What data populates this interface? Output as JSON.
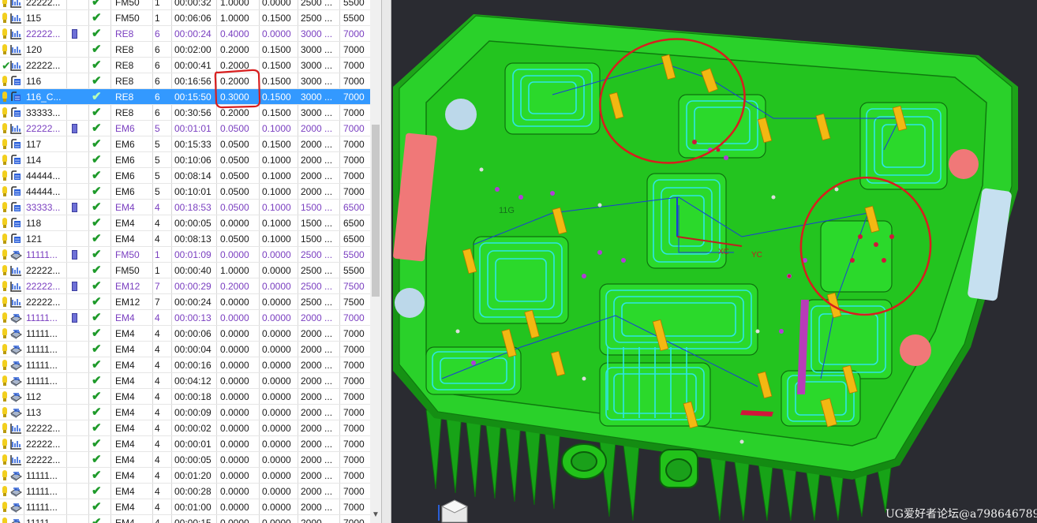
{
  "navigator": {
    "rows": [
      {
        "mark": "bulb",
        "op": "path",
        "name": "22222...",
        "param": false,
        "tool": "FM50",
        "n": "1",
        "time": "00:00:32",
        "a": "1.0000",
        "b": "0.0000",
        "s": "2500 ...",
        "f": "5500"
      },
      {
        "mark": "bulb",
        "op": "path",
        "name": "115",
        "param": false,
        "tool": "FM50",
        "n": "1",
        "time": "00:06:06",
        "a": "1.0000",
        "b": "0.1500",
        "s": "2500 ...",
        "f": "5500"
      },
      {
        "mark": "bulb",
        "op": "path",
        "name": "22222...",
        "param": true,
        "tool": "RE8",
        "n": "6",
        "time": "00:00:24",
        "a": "0.4000",
        "b": "0.0000",
        "s": "3000 ...",
        "f": "7000",
        "group": true
      },
      {
        "mark": "bulb",
        "op": "path",
        "name": "120",
        "param": false,
        "tool": "RE8",
        "n": "6",
        "time": "00:02:00",
        "a": "0.2000",
        "b": "0.1500",
        "s": "3000 ...",
        "f": "7000"
      },
      {
        "mark": "ok",
        "op": "path",
        "name": "22222...",
        "param": false,
        "tool": "RE8",
        "n": "6",
        "time": "00:00:41",
        "a": "0.2000",
        "b": "0.1500",
        "s": "3000 ...",
        "f": "7000"
      },
      {
        "mark": "bulb",
        "op": "zlevel",
        "name": "116",
        "param": false,
        "tool": "RE8",
        "n": "6",
        "time": "00:16:56",
        "a": "0.2000",
        "b": "0.1500",
        "s": "3000 ...",
        "f": "7000"
      },
      {
        "mark": "bulb",
        "op": "zlevel",
        "name": "116_C...",
        "param": false,
        "tool": "RE8",
        "n": "6",
        "time": "00:15:50",
        "a": "0.3000",
        "b": "0.1500",
        "s": "3000 ...",
        "f": "7000",
        "hl": true
      },
      {
        "mark": "bulb",
        "op": "zlevel",
        "name": "33333...",
        "param": false,
        "tool": "RE8",
        "n": "6",
        "time": "00:30:56",
        "a": "0.2000",
        "b": "0.1500",
        "s": "3000 ...",
        "f": "7000"
      },
      {
        "mark": "bulb",
        "op": "path",
        "name": "22222...",
        "param": true,
        "tool": "EM6",
        "n": "5",
        "time": "00:01:01",
        "a": "0.0500",
        "b": "0.1000",
        "s": "2000 ...",
        "f": "7000",
        "group": true
      },
      {
        "mark": "bulb",
        "op": "zlevel",
        "name": "117",
        "param": false,
        "tool": "EM6",
        "n": "5",
        "time": "00:15:33",
        "a": "0.0500",
        "b": "0.1500",
        "s": "2000 ...",
        "f": "7000"
      },
      {
        "mark": "bulb",
        "op": "zlevel",
        "name": "114",
        "param": false,
        "tool": "EM6",
        "n": "5",
        "time": "00:10:06",
        "a": "0.0500",
        "b": "0.1000",
        "s": "2000 ...",
        "f": "7000"
      },
      {
        "mark": "bulb",
        "op": "zlevel",
        "name": "44444...",
        "param": false,
        "tool": "EM6",
        "n": "5",
        "time": "00:08:14",
        "a": "0.0500",
        "b": "0.1000",
        "s": "2000 ...",
        "f": "7000"
      },
      {
        "mark": "bulb",
        "op": "zlevel",
        "name": "44444...",
        "param": false,
        "tool": "EM6",
        "n": "5",
        "time": "00:10:01",
        "a": "0.0500",
        "b": "0.1000",
        "s": "2000 ...",
        "f": "7000"
      },
      {
        "mark": "bulb",
        "op": "zlevel",
        "name": "33333...",
        "param": true,
        "tool": "EM4",
        "n": "4",
        "time": "00:18:53",
        "a": "0.0500",
        "b": "0.1000",
        "s": "1500 ...",
        "f": "6500",
        "group": true
      },
      {
        "mark": "bulb",
        "op": "zlevel",
        "name": "118",
        "param": false,
        "tool": "EM4",
        "n": "4",
        "time": "00:00:05",
        "a": "0.0000",
        "b": "0.1000",
        "s": "1500 ...",
        "f": "6500"
      },
      {
        "mark": "bulb",
        "op": "zlevel",
        "name": "121",
        "param": false,
        "tool": "EM4",
        "n": "4",
        "time": "00:08:13",
        "a": "0.0500",
        "b": "0.1000",
        "s": "1500 ...",
        "f": "6500"
      },
      {
        "mark": "bulb",
        "op": "face",
        "name": "11111...",
        "param": true,
        "tool": "FM50",
        "n": "1",
        "time": "00:01:09",
        "a": "0.0000",
        "b": "0.0000",
        "s": "2500 ...",
        "f": "5500",
        "group": true
      },
      {
        "mark": "bulb",
        "op": "path",
        "name": "22222...",
        "param": false,
        "tool": "FM50",
        "n": "1",
        "time": "00:00:40",
        "a": "1.0000",
        "b": "0.0000",
        "s": "2500 ...",
        "f": "5500"
      },
      {
        "mark": "bulb",
        "op": "path",
        "name": "22222...",
        "param": true,
        "tool": "EM12",
        "n": "7",
        "time": "00:00:29",
        "a": "0.2000",
        "b": "0.0000",
        "s": "2500 ...",
        "f": "7500",
        "group": true
      },
      {
        "mark": "bulb",
        "op": "path",
        "name": "22222...",
        "param": false,
        "tool": "EM12",
        "n": "7",
        "time": "00:00:24",
        "a": "0.0000",
        "b": "0.0000",
        "s": "2500 ...",
        "f": "7500"
      },
      {
        "mark": "bulb",
        "op": "face",
        "name": "11111...",
        "param": true,
        "tool": "EM4",
        "n": "4",
        "time": "00:00:13",
        "a": "0.0000",
        "b": "0.0000",
        "s": "2000 ...",
        "f": "7000",
        "group": true
      },
      {
        "mark": "bulb",
        "op": "face",
        "name": "11111...",
        "param": false,
        "tool": "EM4",
        "n": "4",
        "time": "00:00:06",
        "a": "0.0000",
        "b": "0.0000",
        "s": "2000 ...",
        "f": "7000"
      },
      {
        "mark": "bulb",
        "op": "face",
        "name": "11111...",
        "param": false,
        "tool": "EM4",
        "n": "4",
        "time": "00:00:04",
        "a": "0.0000",
        "b": "0.0000",
        "s": "2000 ...",
        "f": "7000"
      },
      {
        "mark": "bulb",
        "op": "face",
        "name": "11111...",
        "param": false,
        "tool": "EM4",
        "n": "4",
        "time": "00:00:16",
        "a": "0.0000",
        "b": "0.0000",
        "s": "2000 ...",
        "f": "7000"
      },
      {
        "mark": "bulb",
        "op": "face",
        "name": "11111...",
        "param": false,
        "tool": "EM4",
        "n": "4",
        "time": "00:04:12",
        "a": "0.0000",
        "b": "0.0000",
        "s": "2000 ...",
        "f": "7000"
      },
      {
        "mark": "bulb",
        "op": "face",
        "name": "112",
        "param": false,
        "tool": "EM4",
        "n": "4",
        "time": "00:00:18",
        "a": "0.0000",
        "b": "0.0000",
        "s": "2000 ...",
        "f": "7000"
      },
      {
        "mark": "bulb",
        "op": "face",
        "name": "113",
        "param": false,
        "tool": "EM4",
        "n": "4",
        "time": "00:00:09",
        "a": "0.0000",
        "b": "0.0000",
        "s": "2000 ...",
        "f": "7000"
      },
      {
        "mark": "bulb",
        "op": "path",
        "name": "22222...",
        "param": false,
        "tool": "EM4",
        "n": "4",
        "time": "00:00:02",
        "a": "0.0000",
        "b": "0.0000",
        "s": "2000 ...",
        "f": "7000"
      },
      {
        "mark": "bulb",
        "op": "path",
        "name": "22222...",
        "param": false,
        "tool": "EM4",
        "n": "4",
        "time": "00:00:01",
        "a": "0.0000",
        "b": "0.0000",
        "s": "2000 ...",
        "f": "7000"
      },
      {
        "mark": "bulb",
        "op": "path",
        "name": "22222...",
        "param": false,
        "tool": "EM4",
        "n": "4",
        "time": "00:00:05",
        "a": "0.0000",
        "b": "0.0000",
        "s": "2000 ...",
        "f": "7000"
      },
      {
        "mark": "bulb",
        "op": "face",
        "name": "11111...",
        "param": false,
        "tool": "EM4",
        "n": "4",
        "time": "00:01:20",
        "a": "0.0000",
        "b": "0.0000",
        "s": "2000 ...",
        "f": "7000"
      },
      {
        "mark": "bulb",
        "op": "face",
        "name": "11111...",
        "param": false,
        "tool": "EM4",
        "n": "4",
        "time": "00:00:28",
        "a": "0.0000",
        "b": "0.0000",
        "s": "2000 ...",
        "f": "7000"
      },
      {
        "mark": "bulb",
        "op": "face",
        "name": "11111...",
        "param": false,
        "tool": "EM4",
        "n": "4",
        "time": "00:01:00",
        "a": "0.0000",
        "b": "0.0000",
        "s": "2000 ...",
        "f": "7000"
      },
      {
        "mark": "bulb",
        "op": "face",
        "name": "11111...",
        "param": false,
        "tool": "EM4",
        "n": "4",
        "time": "00:00:15",
        "a": "0.0000",
        "b": "0.0000",
        "s": "2000 ...",
        "f": "7000"
      }
    ]
  },
  "viewport": {
    "part_label": "11G",
    "axis_labels": {
      "xc": "XC",
      "yc": "YC"
    },
    "colors": {
      "background": "#2a2b31",
      "part": "#22c21a",
      "toolpath": "#2ee6e6",
      "tool_holder": "#f3b812",
      "annotation": "#d81e1e",
      "pad_red": "#f07878",
      "pad_blue": "#c6e0f0"
    }
  },
  "watermark": "UG爱好者论坛@a798646789"
}
